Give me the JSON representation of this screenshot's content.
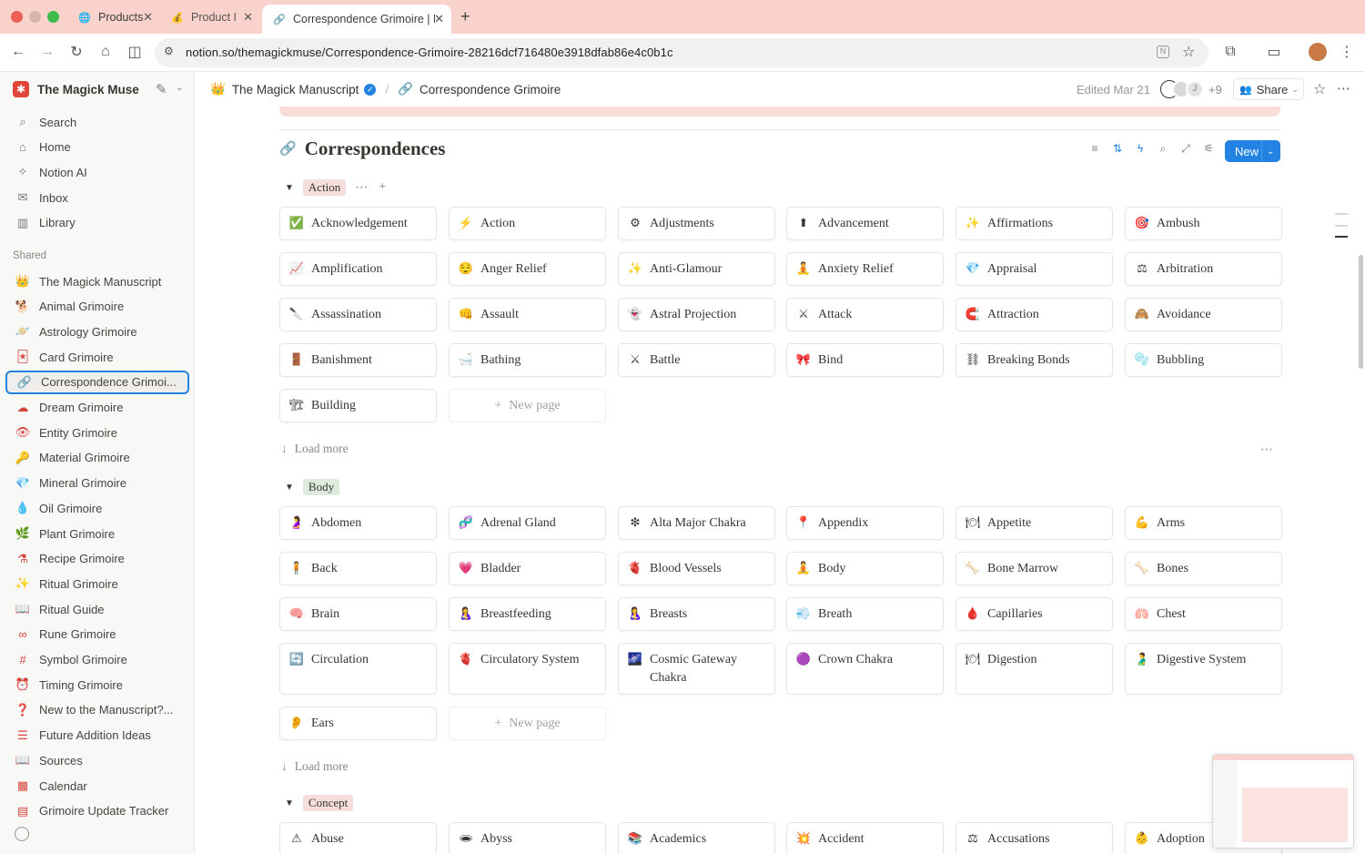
{
  "browser": {
    "tabs": [
      {
        "title": "Products",
        "icon": "globe-icon",
        "active": false
      },
      {
        "title": "Product I",
        "icon": "money-bag-icon",
        "active": false
      },
      {
        "title": "Correspondence Grimoire | N",
        "icon": "link-icon",
        "active": true
      }
    ],
    "url": "notion.so/themagickmuse/Correspondence-Grimoire-28216dcf716480e3918dfab86e4c0b1c"
  },
  "sidebar": {
    "workspace": "The Magick Muse",
    "nav": [
      {
        "label": "Search",
        "icon": "search-icon"
      },
      {
        "label": "Home",
        "icon": "home-icon"
      },
      {
        "label": "Notion AI",
        "icon": "ai-icon"
      },
      {
        "label": "Inbox",
        "icon": "inbox-icon"
      },
      {
        "label": "Library",
        "icon": "library-icon"
      }
    ],
    "section_label": "Shared",
    "pages": [
      {
        "label": "The Magick Manuscript",
        "icon": "crown-icon",
        "glyph": "👑"
      },
      {
        "label": "Animal Grimoire",
        "icon": "dog-icon",
        "glyph": "🐕"
      },
      {
        "label": "Astrology Grimoire",
        "icon": "planet-icon",
        "glyph": "🪐"
      },
      {
        "label": "Card Grimoire",
        "icon": "cards-icon",
        "glyph": "🃏"
      },
      {
        "label": "Correspondence Grimoi...",
        "icon": "link-icon",
        "glyph": "🔗",
        "selected": true
      },
      {
        "label": "Dream Grimoire",
        "icon": "cloud-icon",
        "glyph": "☁"
      },
      {
        "label": "Entity Grimoire",
        "icon": "eye-icon",
        "glyph": "👁"
      },
      {
        "label": "Material Grimoire",
        "icon": "key-icon",
        "glyph": "🔑"
      },
      {
        "label": "Mineral Grimoire",
        "icon": "gem-icon",
        "glyph": "💎"
      },
      {
        "label": "Oil Grimoire",
        "icon": "drop-icon",
        "glyph": "💧"
      },
      {
        "label": "Plant Grimoire",
        "icon": "leaf-icon",
        "glyph": "🌿"
      },
      {
        "label": "Recipe Grimoire",
        "icon": "flask-icon",
        "glyph": "⚗"
      },
      {
        "label": "Ritual Grimoire",
        "icon": "wand-icon",
        "glyph": "✨"
      },
      {
        "label": "Ritual Guide",
        "icon": "book-icon",
        "glyph": "📖"
      },
      {
        "label": "Rune Grimoire",
        "icon": "infinity-icon",
        "glyph": "∞"
      },
      {
        "label": "Symbol Grimoire",
        "icon": "hash-icon",
        "glyph": "#"
      },
      {
        "label": "Timing Grimoire",
        "icon": "clock-icon",
        "glyph": "⏰"
      },
      {
        "label": "New to the Manuscript?...",
        "icon": "question-icon",
        "glyph": "❓"
      },
      {
        "label": "Future Addition Ideas",
        "icon": "list-icon",
        "glyph": "☰"
      },
      {
        "label": "Sources",
        "icon": "book-open-icon",
        "glyph": "📖"
      },
      {
        "label": "Calendar",
        "icon": "calendar-icon",
        "glyph": "▦"
      },
      {
        "label": "Grimoire Update Tracker",
        "icon": "tracker-icon",
        "glyph": "▤"
      }
    ]
  },
  "topbar": {
    "crumb_parent": "The Magick Manuscript",
    "crumb_current": "Correspondence Grimoire",
    "edited": "Edited Mar 21",
    "avatar_initial": "J",
    "extra_count": "+9",
    "share_label": "Share"
  },
  "database": {
    "title": "Correspondences",
    "new_label": "New",
    "load_more": "Load more",
    "new_page": "New page",
    "groups": [
      {
        "name": "Action",
        "tag_color": "#f5dedb",
        "cards": [
          {
            "label": "Acknowledgement",
            "emoji": "✅"
          },
          {
            "label": "Action",
            "emoji": "⚡"
          },
          {
            "label": "Adjustments",
            "emoji": "⚙"
          },
          {
            "label": "Advancement",
            "emoji": "⬆"
          },
          {
            "label": "Affirmations",
            "emoji": "✨"
          },
          {
            "label": "Ambush",
            "emoji": "🎯"
          },
          {
            "label": "Amplification",
            "emoji": "📈"
          },
          {
            "label": "Anger Relief",
            "emoji": "😌"
          },
          {
            "label": "Anti-Glamour",
            "emoji": "✨"
          },
          {
            "label": "Anxiety Relief",
            "emoji": "🧘"
          },
          {
            "label": "Appraisal",
            "emoji": "💎"
          },
          {
            "label": "Arbitration",
            "emoji": "⚖"
          },
          {
            "label": "Assassination",
            "emoji": "🔪"
          },
          {
            "label": "Assault",
            "emoji": "👊"
          },
          {
            "label": "Astral Projection",
            "emoji": "👻"
          },
          {
            "label": "Attack",
            "emoji": "⚔"
          },
          {
            "label": "Attraction",
            "emoji": "🧲"
          },
          {
            "label": "Avoidance",
            "emoji": "🙈"
          },
          {
            "label": "Banishment",
            "emoji": "🚪"
          },
          {
            "label": "Bathing",
            "emoji": "🛁"
          },
          {
            "label": "Battle",
            "emoji": "⚔"
          },
          {
            "label": "Bind",
            "emoji": "🎀"
          },
          {
            "label": "Breaking Bonds",
            "emoji": "⛓"
          },
          {
            "label": "Bubbling",
            "emoji": "🫧"
          },
          {
            "label": "Building",
            "emoji": "🏗"
          }
        ]
      },
      {
        "name": "Body",
        "tag_color": "#dfeadf",
        "cards": [
          {
            "label": "Abdomen",
            "emoji": "🤰"
          },
          {
            "label": "Adrenal Gland",
            "emoji": "🧬"
          },
          {
            "label": "Alta Major Chakra",
            "emoji": "❇"
          },
          {
            "label": "Appendix",
            "emoji": "📍"
          },
          {
            "label": "Appetite",
            "emoji": "🍽"
          },
          {
            "label": "Arms",
            "emoji": "💪"
          },
          {
            "label": "Back",
            "emoji": "🧍"
          },
          {
            "label": "Bladder",
            "emoji": "💗"
          },
          {
            "label": "Blood Vessels",
            "emoji": "🫀"
          },
          {
            "label": "Body",
            "emoji": "🧘"
          },
          {
            "label": "Bone Marrow",
            "emoji": "🦴"
          },
          {
            "label": "Bones",
            "emoji": "🦴"
          },
          {
            "label": "Brain",
            "emoji": "🧠"
          },
          {
            "label": "Breastfeeding",
            "emoji": "🤱"
          },
          {
            "label": "Breasts",
            "emoji": "🤱"
          },
          {
            "label": "Breath",
            "emoji": "💨"
          },
          {
            "label": "Capillaries",
            "emoji": "🩸"
          },
          {
            "label": "Chest",
            "emoji": "🫁"
          },
          {
            "label": "Circulation",
            "emoji": "🔄"
          },
          {
            "label": "Circulatory System",
            "emoji": "🫀"
          },
          {
            "label": "Cosmic Gateway Chakra",
            "emoji": "🌌"
          },
          {
            "label": "Crown Chakra",
            "emoji": "🟣"
          },
          {
            "label": "Digestion",
            "emoji": "🍽"
          },
          {
            "label": "Digestive System",
            "emoji": "🫃"
          },
          {
            "label": "Ears",
            "emoji": "👂"
          }
        ]
      },
      {
        "name": "Concept",
        "tag_color": "#f5dedb",
        "cards": [
          {
            "label": "Abuse",
            "emoji": "⚠"
          },
          {
            "label": "Abyss",
            "emoji": "🕳"
          },
          {
            "label": "Academics",
            "emoji": "📚"
          },
          {
            "label": "Accident",
            "emoji": "💥"
          },
          {
            "label": "Accusations",
            "emoji": "⚖"
          },
          {
            "label": "Adoption",
            "emoji": "👶"
          }
        ]
      }
    ]
  },
  "colors": {
    "accent": "#2383e2",
    "tabbar": "#f9d3cb",
    "banner": "#f9dcd8"
  }
}
